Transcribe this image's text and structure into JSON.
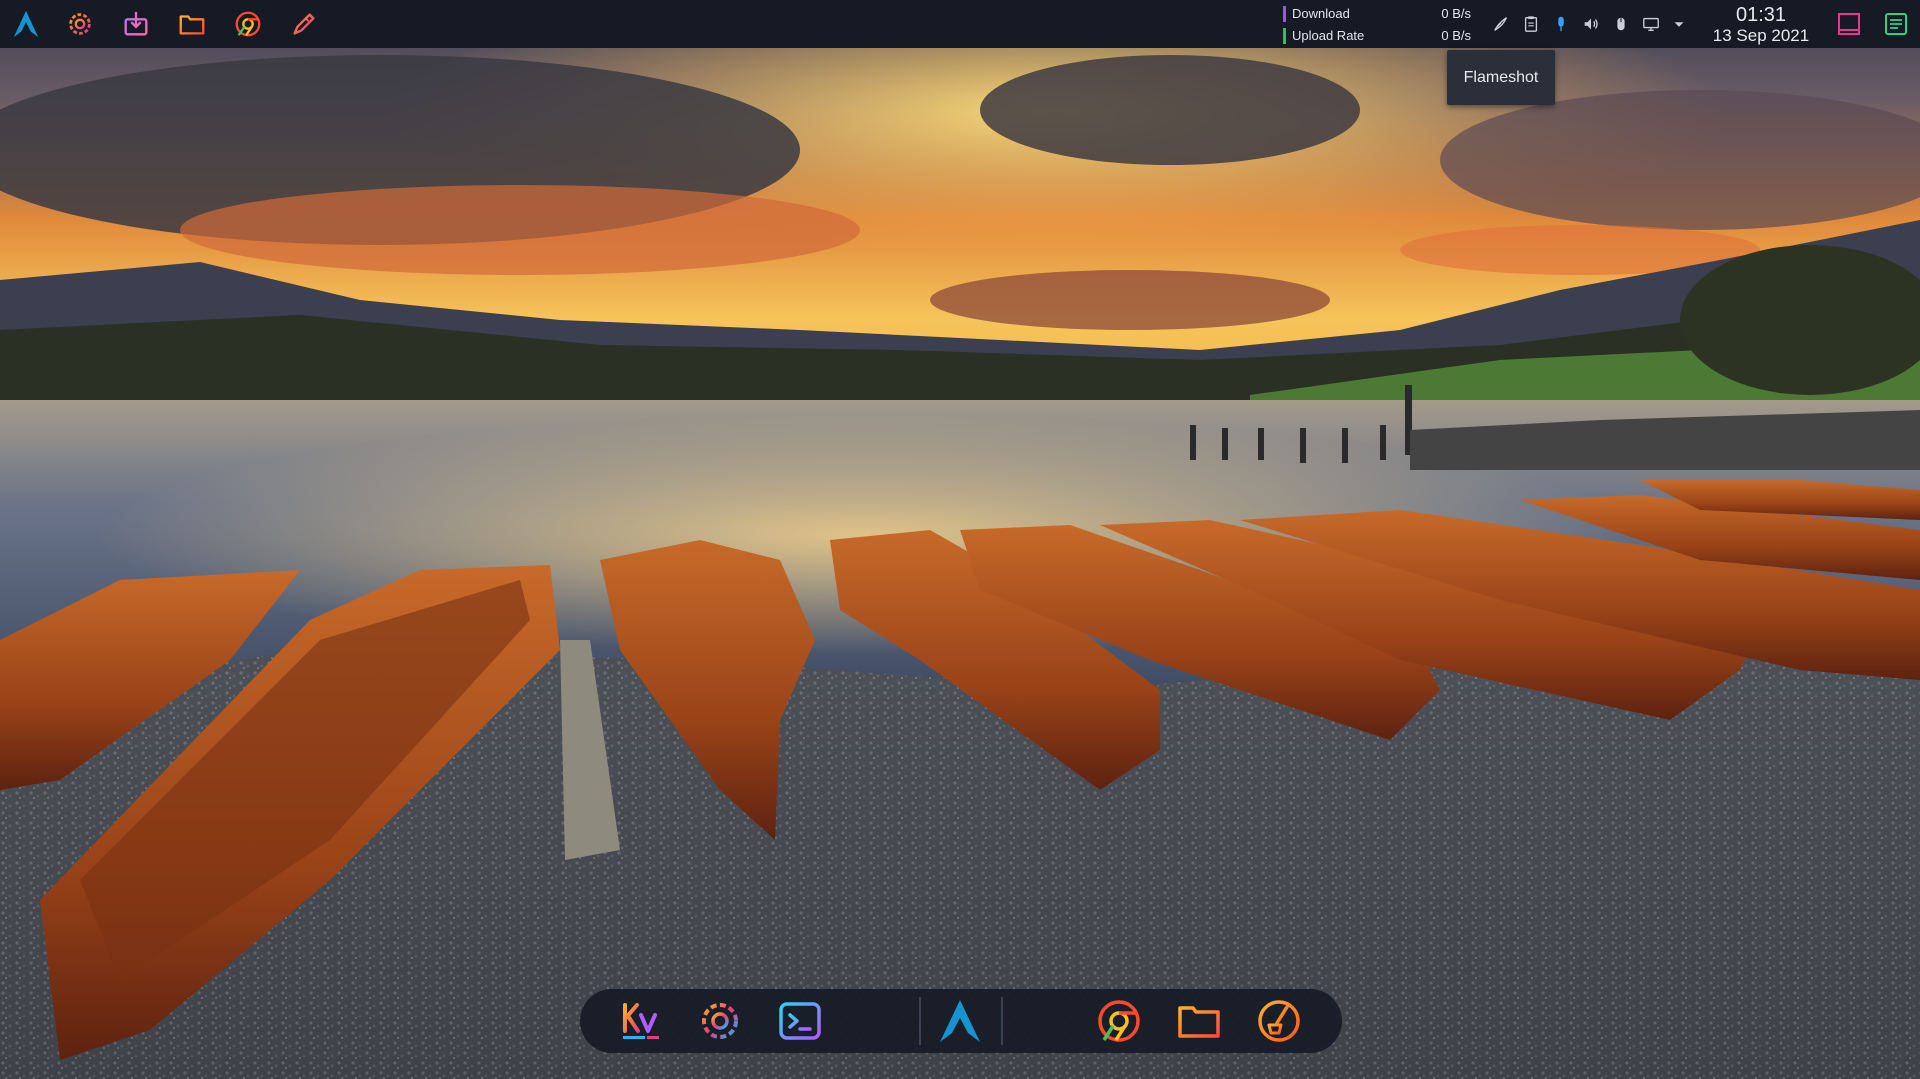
{
  "top_panel": {
    "launchers": [
      {
        "name": "app-launcher",
        "icon": "arch-logo-icon"
      },
      {
        "name": "system-settings",
        "icon": "gear-icon"
      },
      {
        "name": "discover",
        "icon": "software-center-icon"
      },
      {
        "name": "file-manager",
        "icon": "folder-icon"
      },
      {
        "name": "chrome",
        "icon": "chrome-icon"
      },
      {
        "name": "kate",
        "icon": "pen-icon"
      }
    ],
    "network": {
      "download_label": "Download",
      "download_value": "0 B/s",
      "upload_label": "Upload Rate",
      "upload_value": "0 B/s",
      "download_color": "#8b5cf6",
      "upload_color": "#22c55e"
    },
    "tray": [
      {
        "name": "flameshot",
        "icon": "flameshot-icon"
      },
      {
        "name": "clipboard",
        "icon": "clipboard-icon"
      },
      {
        "name": "microphone",
        "icon": "microphone-icon"
      },
      {
        "name": "volume",
        "icon": "speaker-icon"
      },
      {
        "name": "mouse",
        "icon": "mouse-icon"
      },
      {
        "name": "display",
        "icon": "monitor-icon"
      },
      {
        "name": "tray-expander",
        "icon": "chevron-down-icon"
      }
    ],
    "clock": {
      "time": "01:31",
      "date": "13 Sep 2021"
    }
  },
  "tooltip": {
    "text": "Flameshot"
  },
  "dock": {
    "items": [
      {
        "name": "kvantum",
        "icon": "kvantum-icon",
        "label_text": "Kv"
      },
      {
        "name": "system-settings",
        "icon": "gear-icon"
      },
      {
        "name": "terminal",
        "icon": "terminal-icon"
      },
      {
        "name": "arch-menu",
        "icon": "arch-logo-icon"
      },
      {
        "name": "chrome",
        "icon": "chrome-icon"
      },
      {
        "name": "file-manager",
        "icon": "folder-icon"
      },
      {
        "name": "cleaner",
        "icon": "broom-icon"
      }
    ]
  },
  "colors": {
    "panel_bg": "#151a25",
    "accent_blue": "#1793d1",
    "orange": "#ff7a1a",
    "magenta": "#e040fb"
  }
}
